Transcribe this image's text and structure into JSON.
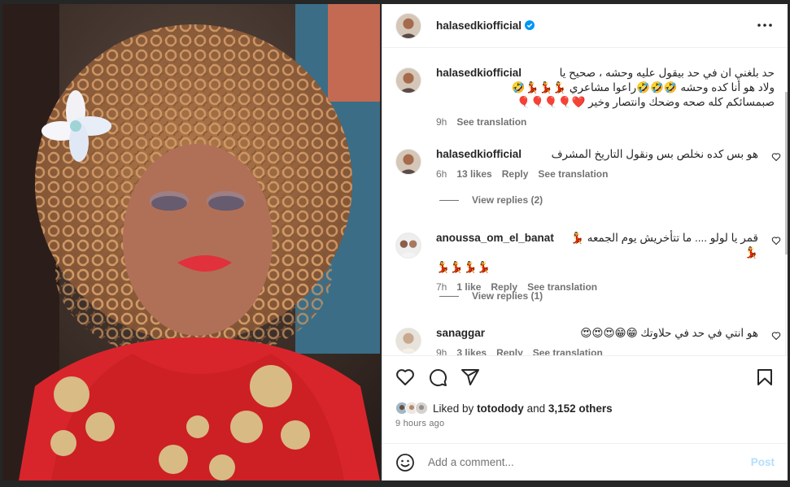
{
  "post": {
    "author": "halasedkiofficial",
    "colors": {
      "verified": "#0095f6",
      "text": "#262626",
      "muted": "#737373",
      "post_disabled": "#b2dffc"
    }
  },
  "comments": [
    {
      "username": "halasedkiofficial",
      "verified": true,
      "lines": [
        "حد بلغني ان في حد بيقول عليه وحشه ، صحيح يا",
        "ولاد هو أنا كده وحشه 🤣🤣🤣راعوا مشاعري 💃💃💃🤣",
        "صبمسائكم كله صحه وضحك وانتصار وخير ❤️🎈🎈🎈🎈"
      ],
      "time": "9h",
      "translation": "See translation"
    },
    {
      "username": "halasedkiofficial",
      "verified": true,
      "text": "هو بس كده نخلص بس ونقول التاريخ المشرف",
      "time": "6h",
      "likes": "13 likes",
      "reply": "Reply",
      "translation": "See translation",
      "replies": "View replies (2)"
    },
    {
      "username": "anoussa_om_el_banat",
      "verified": false,
      "text": "قمر يا لولو .... ما تتأخريش يوم الجمعه 💃💃",
      "text2": "💃💃💃💃",
      "time": "7h",
      "likes": "1 like",
      "reply": "Reply",
      "translation": "See translation",
      "replies": "View replies (1)"
    },
    {
      "username": "sanaggar",
      "verified": false,
      "text": "هو انتي في حد في حلاوتك 😁😁😍😍😍",
      "time": "9h",
      "likes": "3 likes",
      "reply": "Reply",
      "translation": "See translation"
    }
  ],
  "likes": {
    "prefix": "Liked by",
    "user": "totodody",
    "middle": "and",
    "others": "3,152 others"
  },
  "timestamp": "9 hours ago",
  "add_comment": {
    "placeholder": "Add a comment...",
    "post_label": "Post"
  },
  "icons": [
    "more-icon",
    "heart-icon",
    "comment-icon",
    "share-icon",
    "bookmark-icon",
    "emoji-icon",
    "verified-icon"
  ]
}
